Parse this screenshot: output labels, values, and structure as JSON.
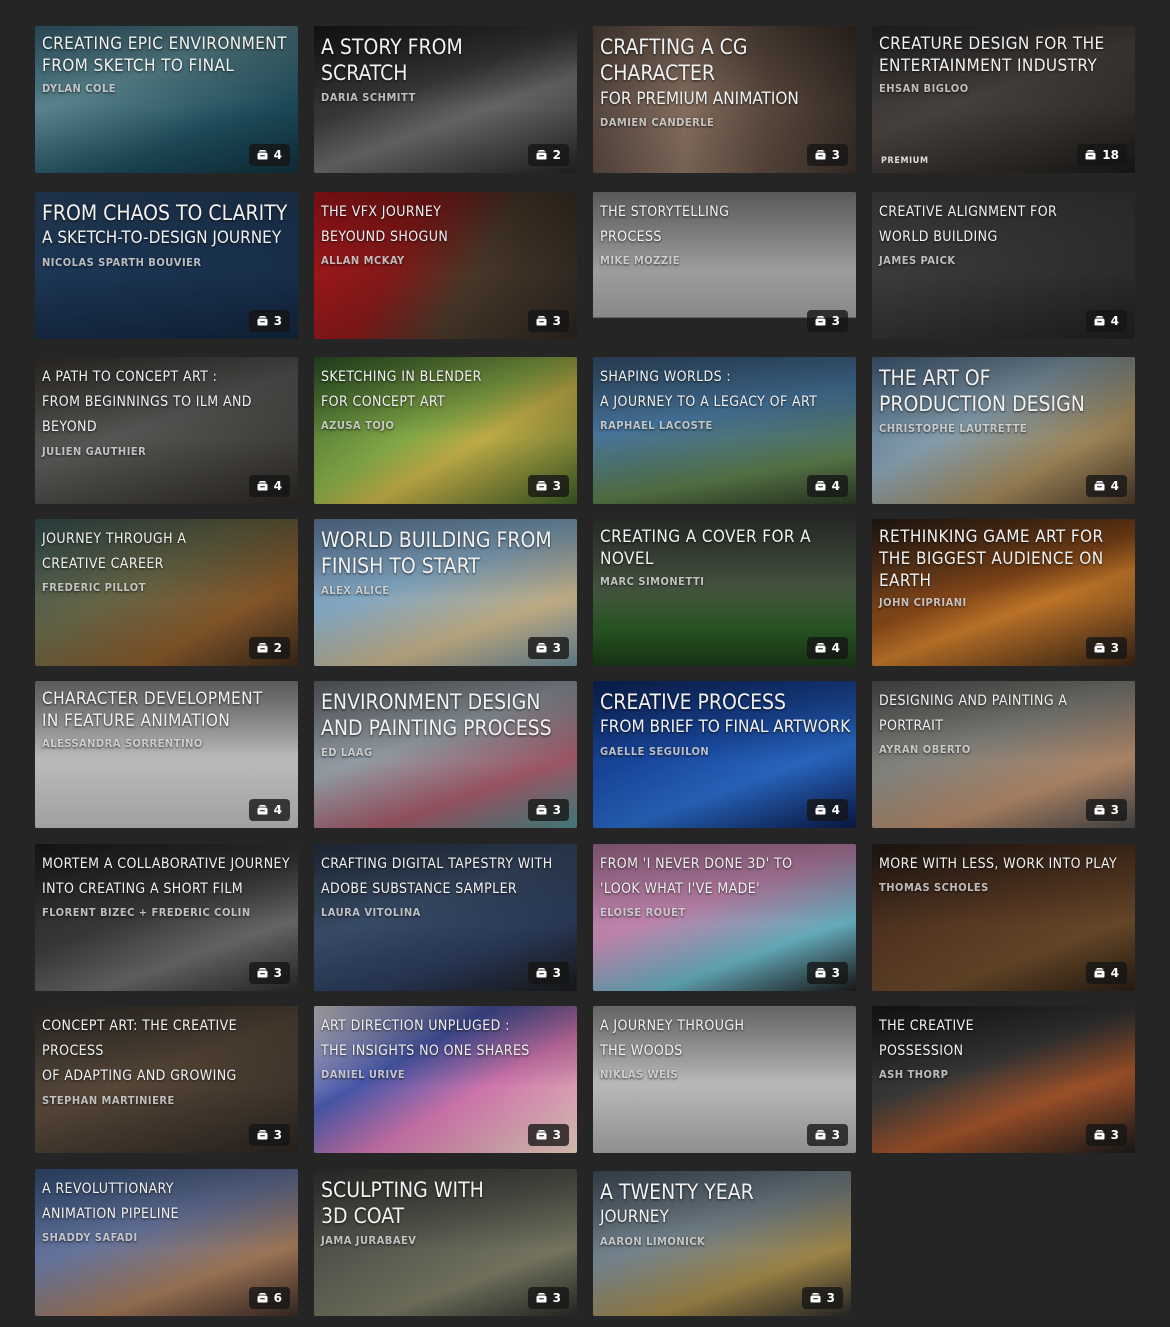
{
  "cards": [
    {
      "title_lines": [
        "Creating Epic Environment",
        "From Sketch to Final"
      ],
      "author": "Dylan Cole",
      "count": "4",
      "bg": "linear-gradient(160deg,#3c6a7c 0%,#5d8a94 35%,#1e4d5c 70%,#0f2f3c 100%)"
    },
    {
      "title_lines": [
        "A Story From",
        "Scratch"
      ],
      "author": "Daria Schmitt",
      "count": "2",
      "bg": "linear-gradient(160deg,#1a1a1a 0%,#3a3a3a 40%,#6a6a6a 60%,#222 100%)"
    },
    {
      "title_lines": [
        "Crafting a CG Character",
        "for Premium Animation"
      ],
      "author": "Damien Canderle",
      "count": "3",
      "bg": "linear-gradient(90deg,#5a4a42 0%,#8a7262 35%,#5e4c40 65%,#3a2e28 100%)"
    },
    {
      "title_lines": [
        "Creature Design for the",
        "Entertainment Industry"
      ],
      "author": "Ehsan Bigloo",
      "count": "18",
      "premium": "Premium",
      "bg": "linear-gradient(160deg,#2a2a2a 0%,#4a4440 45%,#1a1816 100%)"
    },
    {
      "title_lines": [
        "From Chaos to Clarity",
        "A Sketch-to-Design Journey"
      ],
      "author": "Nicolas Sparth Bouvier",
      "count": "3",
      "bg": "linear-gradient(170deg,#2c4a6c 0%,#1e3a5a 40%,#12243c 100%)"
    },
    {
      "title_lines": [
        "The VFX Journey",
        "Beyound Shogun"
      ],
      "author": "Allan McKay",
      "count": "3",
      "bg": "linear-gradient(120deg,#b0161c 0%,#8a1a1a 35%,#4a3a2a 60%,#2a2420 100%)"
    },
    {
      "title_lines": [
        "The Storytelling",
        "Process"
      ],
      "author": "Mike Mozzie",
      "count": "3",
      "bg": "linear-gradient(180deg,#8a8a8a 0%,#a6a6a6 50%,#9a9a9a 85%,#2a2a2a 86%,#2a2a2a 100%)"
    },
    {
      "title_lines": [
        "Creative Alignment for",
        "World Building"
      ],
      "author": "James Paick",
      "count": "4",
      "bg": "linear-gradient(160deg,#4a4a48 0%,#3a3a38 45%,#1f1f1e 100%)"
    },
    {
      "title_lines": [
        "A Path to Concept Art :",
        "From Beginnings to ILM and Beyond"
      ],
      "author": "Julien Gauthier",
      "count": "4",
      "bg": "linear-gradient(160deg,#3a3632 0%,#5a5a58 45%,#2a2622 100%)"
    },
    {
      "title_lines": [
        "Sketching in Blender",
        "for Concept Art"
      ],
      "author": "Azusa Tojo",
      "count": "3",
      "bg": "linear-gradient(150deg,#2e5a2a 0%,#8ab04a 45%,#c8b44a 60%,#3a5a24 100%)"
    },
    {
      "title_lines": [
        "Shaping Worlds :",
        "A Journey to a Legacy of Art"
      ],
      "author": "Raphael Lacoste",
      "count": "4",
      "bg": "linear-gradient(170deg,#3a5a7a 0%,#4a7aa4 40%,#5a7a4a 75%,#2a3a24 100%)"
    },
    {
      "title_lines": [
        "The Art of",
        "Production Design"
      ],
      "author": "Christophe Lautrette",
      "count": "4",
      "bg": "linear-gradient(150deg,#4a6a8a 0%,#8aa4b4 40%,#a48a5a 70%,#4a3a2a 100%)"
    },
    {
      "title_lines": [
        "Journey Through a",
        "Creative Career"
      ],
      "author": "Frederic Pillot",
      "count": "2",
      "bg": "linear-gradient(150deg,#3a5a5a 0%,#6a6a4a 40%,#8a5a2a 70%,#3a2a1a 100%)"
    },
    {
      "title_lines": [
        "World Building From",
        "Finish to Start"
      ],
      "author": "Alex Alice",
      "count": "3",
      "bg": "linear-gradient(160deg,#6a8ab0 0%,#8ab0cc 40%,#c8b48a 70%,#6a8a9a 100%)"
    },
    {
      "title_lines": [
        "Creating a Cover for a",
        "Novel"
      ],
      "author": "Marc Simonetti",
      "count": "4",
      "bg": "linear-gradient(180deg,#3a3e3a 0%,#4a5a44 45%,#2a5a24 75%,#1a3a16 100%)"
    },
    {
      "title_lines": [
        "Rethinking Game Art for",
        "the Biggest Audience on Earth"
      ],
      "author": "John Cipriani",
      "count": "3",
      "bg": "linear-gradient(160deg,#2a1e16 0%,#8a4a1a 45%,#c87a2a 60%,#3a2416 100%)"
    },
    {
      "title_lines": [
        "Character Development",
        "in Feature Animation"
      ],
      "author": "Alessandra Sorrentino",
      "count": "4",
      "bg": "linear-gradient(180deg,#8a8a8a 0%,#c4c4c4 50%,#bcbcbc 100%)"
    },
    {
      "title_lines": [
        "Environment Design",
        "and Painting Process"
      ],
      "author": "Ed Laag",
      "count": "3",
      "bg": "linear-gradient(160deg,#6a6e74 0%,#9aa4ac 40%,#a45a6a 70%,#4a8a8a 100%)"
    },
    {
      "title_lines": [
        "Creative Process",
        "From Brief to Final Artwork"
      ],
      "author": "Gaelle Seguilon",
      "count": "4",
      "bg": "linear-gradient(160deg,#0e2a6a 0%,#1a4aa4 40%,#2a6ac8 65%,#0a1a4a 100%)"
    },
    {
      "title_lines": [
        "Designing and Painting a",
        "Portrait"
      ],
      "author": "Ayran Oberto",
      "count": "3",
      "bg": "linear-gradient(160deg,#5a5a5a 0%,#8a8a84 40%,#b48a6a 70%,#4a4a4a 100%)"
    },
    {
      "title_lines": [
        "Mortem a Collaborative Journey",
        "Into Creating a Short Film"
      ],
      "author": "Florent Bizec + Frederic Colin",
      "count": "3",
      "bg": "linear-gradient(160deg,#1e1e1e 0%,#3a3c3c 45%,#6a6a6a 70%,#2a2a2a 100%)"
    },
    {
      "title_lines": [
        "Crafting Digital Tapestry with",
        "Adobe Substance Sampler"
      ],
      "author": "Laura Vitolina",
      "count": "3",
      "bg": "linear-gradient(160deg,#2a3a4a 0%,#3a4e6a 40%,#2a3a5a 70%,#1a1a1a 100%)"
    },
    {
      "title_lines": [
        "From 'I Never Done 3D' to",
        "'Look What I've Made'"
      ],
      "author": "Eloise Rouet",
      "count": "3",
      "bg": "linear-gradient(160deg,#b87aa4 0%,#c88ab4 40%,#6ab4c4 70%,#1a1a1a 100%)"
    },
    {
      "title_lines": [
        "More With Less, Work Into Play"
      ],
      "author": "Thomas Scholes",
      "count": "4",
      "bg": "linear-gradient(160deg,#2a1e16 0%,#5a3a24 45%,#6a4a2a 70%,#2a1e14 100%)"
    },
    {
      "title_lines": [
        "Concept Art: The Creative Process",
        "of Adapting and Growing"
      ],
      "author": "Stephan Martiniere",
      "count": "3",
      "bg": "linear-gradient(160deg,#3a3632 0%,#5a4a3a 45%,#2a2420 100%)"
    },
    {
      "title_lines": [
        "Art Direction Unpluged :",
        "The Insights No One Shares"
      ],
      "author": "Daniel Urive",
      "count": "3",
      "bg": "linear-gradient(150deg,#e8e4e8 0%,#4a5ab0 35%,#d87ab4 60%,#f0d8c4 100%)"
    },
    {
      "title_lines": [
        "A Journey Through",
        "the Woods"
      ],
      "author": "Niklas Weis",
      "count": "3",
      "bg": "linear-gradient(180deg,#9a9a9a 0%,#c4c4c4 50%,#a8a8a8 100%)"
    },
    {
      "title_lines": [
        "The Creative",
        "Possession"
      ],
      "author": "Ash Thorp",
      "count": "3",
      "bg": "linear-gradient(160deg,#1a1a1a 0%,#3a3a3a 40%,#a4542a 65%,#1a1a1a 100%)"
    },
    {
      "title_lines": [
        "A Revoluttionary",
        "Animation Pipeline"
      ],
      "author": "Shaddy Safadi",
      "count": "6",
      "bg": "linear-gradient(160deg,#3a5a8a 0%,#6a7aa4 40%,#a47a5a 70%,#3a2a24 100%)"
    },
    {
      "title_lines": [
        "Sculpting With",
        "3D Coat"
      ],
      "author": "Jama Jurabaev",
      "count": "3",
      "bg": "linear-gradient(160deg,#3a3a38 0%,#5a5a52 40%,#7a7a64 70%,#2a2a28 100%)"
    },
    {
      "title_lines": [
        "A Twenty Year",
        "Journey"
      ],
      "author": "Aaron Limonick",
      "count": "3",
      "bg": "linear-gradient(160deg,#4a5a6a 0%,#7a8a94 40%,#a48a4a 70%,#2a2a2a 100%)"
    }
  ]
}
